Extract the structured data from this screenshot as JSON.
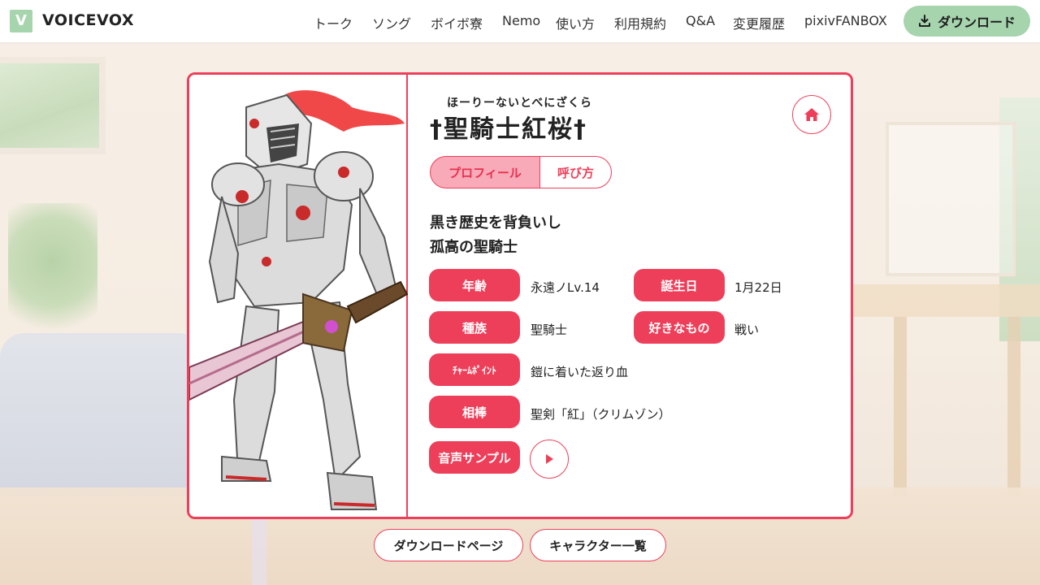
{
  "header": {
    "logo_letter": "V",
    "brand": "VOICEVOX",
    "nav": [
      "トーク",
      "ソング",
      "ボイボ寮",
      "Nemo",
      "使い方",
      "利用規約",
      "Q&A",
      "変更履歴",
      "pixivFANBOX"
    ],
    "download_label": "ダウンロード"
  },
  "character": {
    "furigana": "ほーりーないとべにざくら",
    "name": "†聖騎士紅桜†",
    "tabs": [
      "プロフィール",
      "呼び方"
    ],
    "catch_lines": [
      "黒き歴史を背負いし",
      "孤高の聖騎士"
    ],
    "profile": {
      "age_label": "年齢",
      "age_value": "永遠ノLv.14",
      "birthday_label": "誕生日",
      "birthday_value": "1月22日",
      "race_label": "種族",
      "race_value": "聖騎士",
      "likes_label": "好きなもの",
      "likes_value": "戦い",
      "charm_label": "ﾁｬｰﾑﾎﾟｲﾝﾄ",
      "charm_value": "鎧に着いた返り血",
      "partner_label": "相棒",
      "partner_value": "聖剣「紅」（クリムゾン）",
      "voice_label": "音声サンプル"
    }
  },
  "footer": {
    "download_page": "ダウンロードページ",
    "character_list": "キャラクター一覧"
  },
  "colors": {
    "accent": "#ee3f5a",
    "accent_light": "#f8aab9",
    "green": "#a5d4ad"
  }
}
